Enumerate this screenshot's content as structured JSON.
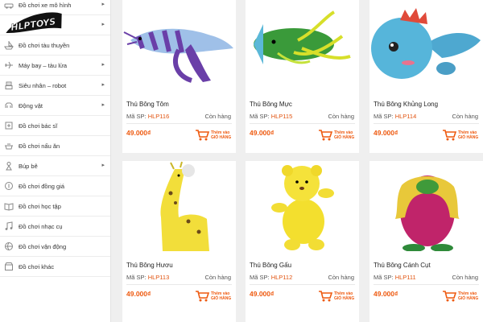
{
  "sidebar": {
    "items": [
      {
        "label": "Đồ chơi xe mô hình",
        "icon": "car-icon",
        "has_submenu": true
      },
      {
        "label": "",
        "icon": "logo",
        "has_submenu": true
      },
      {
        "label": "Đồ chơi tàu thuyền",
        "icon": "boat-icon",
        "has_submenu": false
      },
      {
        "label": "Máy bay – tàu lửa",
        "icon": "plane-icon",
        "has_submenu": true
      },
      {
        "label": "Siêu nhân – robot",
        "icon": "robot-icon",
        "has_submenu": true
      },
      {
        "label": "Động vật",
        "icon": "animal-icon",
        "has_submenu": true
      },
      {
        "label": "Đồ chơi bác sĩ",
        "icon": "doctor-icon",
        "has_submenu": false
      },
      {
        "label": "Đồ chơi nấu ăn",
        "icon": "cooking-icon",
        "has_submenu": false
      },
      {
        "label": "Búp bê",
        "icon": "doll-icon",
        "has_submenu": true
      },
      {
        "label": "Đồ chơi đồng giá",
        "icon": "price-tag-icon",
        "has_submenu": false
      },
      {
        "label": "Đồ chơi học tập",
        "icon": "book-icon",
        "has_submenu": false
      },
      {
        "label": "Đồ chơi nhạc cụ",
        "icon": "music-icon",
        "has_submenu": false
      },
      {
        "label": "Đồ chơi vận động",
        "icon": "ball-icon",
        "has_submenu": false
      },
      {
        "label": "Đồ chơi khác",
        "icon": "toy-box-icon",
        "has_submenu": false
      }
    ]
  },
  "logo": {
    "text": "HLPTOYS"
  },
  "common": {
    "sku_prefix": "Mã SP:",
    "stock_label": "Còn hàng",
    "add_to_cart_line1": "Thêm vào",
    "add_to_cart_line2": "GIỎ HÀNG",
    "arrow": "▸"
  },
  "products": [
    {
      "name": "Thú Bông Tôm",
      "code": "HLP116",
      "price": "49.000₫",
      "image": "shrimp-plush"
    },
    {
      "name": "Thú Bông Mực",
      "code": "HLP115",
      "price": "49.000₫",
      "image": "squid-plush"
    },
    {
      "name": "Thú Bông Khủng Long",
      "code": "HLP114",
      "price": "49.000₫",
      "image": "dinosaur-plush"
    },
    {
      "name": "Thú Bông Hươu",
      "code": "HLP113",
      "price": "49.000₫",
      "image": "giraffe-plush"
    },
    {
      "name": "Thú Bông Gấu",
      "code": "HLP112",
      "price": "49.000₫",
      "image": "bear-plush"
    },
    {
      "name": "Thú Bông Cánh Cụt",
      "code": "HLP111",
      "price": "49.000₫",
      "image": "penguin-plush"
    }
  ],
  "colors": {
    "accent": "#ee5a10",
    "code": "#e2530f"
  }
}
